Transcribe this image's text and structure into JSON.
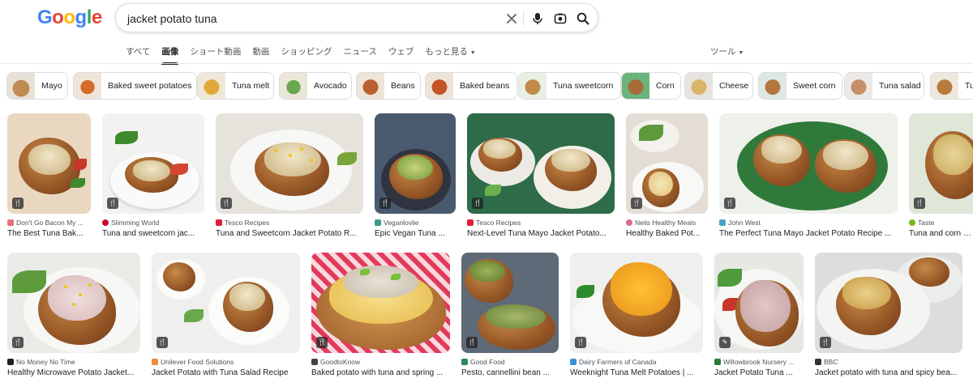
{
  "logo": {
    "letters": [
      "G",
      "o",
      "o",
      "g",
      "l",
      "e"
    ],
    "colors": [
      "#4285f4",
      "#ea4335",
      "#fbbc05",
      "#4285f4",
      "#34a853",
      "#ea4335"
    ]
  },
  "search": {
    "query": "jacket potato tuna"
  },
  "header_icons": [
    "clear-icon",
    "microphone-icon",
    "lens-icon",
    "search-icon"
  ],
  "tabs": [
    "すべて",
    "画像",
    "ショート動画",
    "動画",
    "ショッピング",
    "ニュース",
    "ウェブ",
    "もっと見る"
  ],
  "active_tab": "画像",
  "tools_label": "ツール",
  "chips": [
    "Mayo",
    "Baked sweet potatoes",
    "Tuna melt",
    "Avocado",
    "Beans",
    "Baked beans",
    "Tuna sweetcorn",
    "Corn",
    "Cheese",
    "Sweet corn",
    "Tuna salad",
    "Tu"
  ],
  "results_row1": [
    {
      "source": "Don't Go Bacon My ...",
      "title": "The Best Tuna Bak...",
      "source_color": "#e8717a"
    },
    {
      "source": "Slimming World",
      "title": "Tuna and sweetcorn jac...",
      "source_color": "#c8102e"
    },
    {
      "source": "Tesco Recipes",
      "title": "Tuna and Sweetcorn Jacket Potato R...",
      "source_color": "#e01e37"
    },
    {
      "source": "Veganlovlie",
      "title": "Epic Vegan Tuna ...",
      "source_color": "#3a9b8e"
    },
    {
      "source": "Tesco Recipes",
      "title": "Next-Level Tuna Mayo Jacket Potato...",
      "source_color": "#e01e37"
    },
    {
      "source": "Neils Healthy Meals",
      "title": "Healthy Baked Pot...",
      "source_color": "#d96a8a"
    },
    {
      "source": "John West",
      "title": "The Perfect Tuna Mayo Jacket Potato Recipe ...",
      "source_color": "#4aa3c2"
    },
    {
      "source": "Taste",
      "title": "Tuna and corn jack",
      "source_color": "#7ab51d"
    }
  ],
  "results_row2": [
    {
      "source": "No Money No Time",
      "title": "Healthy Microwave Potato Jacket...",
      "source_color": "#222222"
    },
    {
      "source": "Unilever Food Solutions",
      "title": "Jacket Potato with Tuna Salad Recipe",
      "source_color": "#f08a3c"
    },
    {
      "source": "GoodtoKnow",
      "title": "Baked potato with tuna and spring ...",
      "source_color": "#444444"
    },
    {
      "source": "Good Food",
      "title": "Pesto, cannellini bean ...",
      "source_color": "#2a8a5c"
    },
    {
      "source": "Dairy Farmers of Canada",
      "title": "Weeknight Tuna Melt Potatoes | ...",
      "source_color": "#3b8fd1"
    },
    {
      "source": "Willowbrook Nursery ...",
      "title": "Jacket Potato Tuna ...",
      "source_color": "#2d7a3a"
    },
    {
      "source": "BBC",
      "title": "Jacket potato with tuna and spicy bea...",
      "source_color": "#333333"
    }
  ]
}
